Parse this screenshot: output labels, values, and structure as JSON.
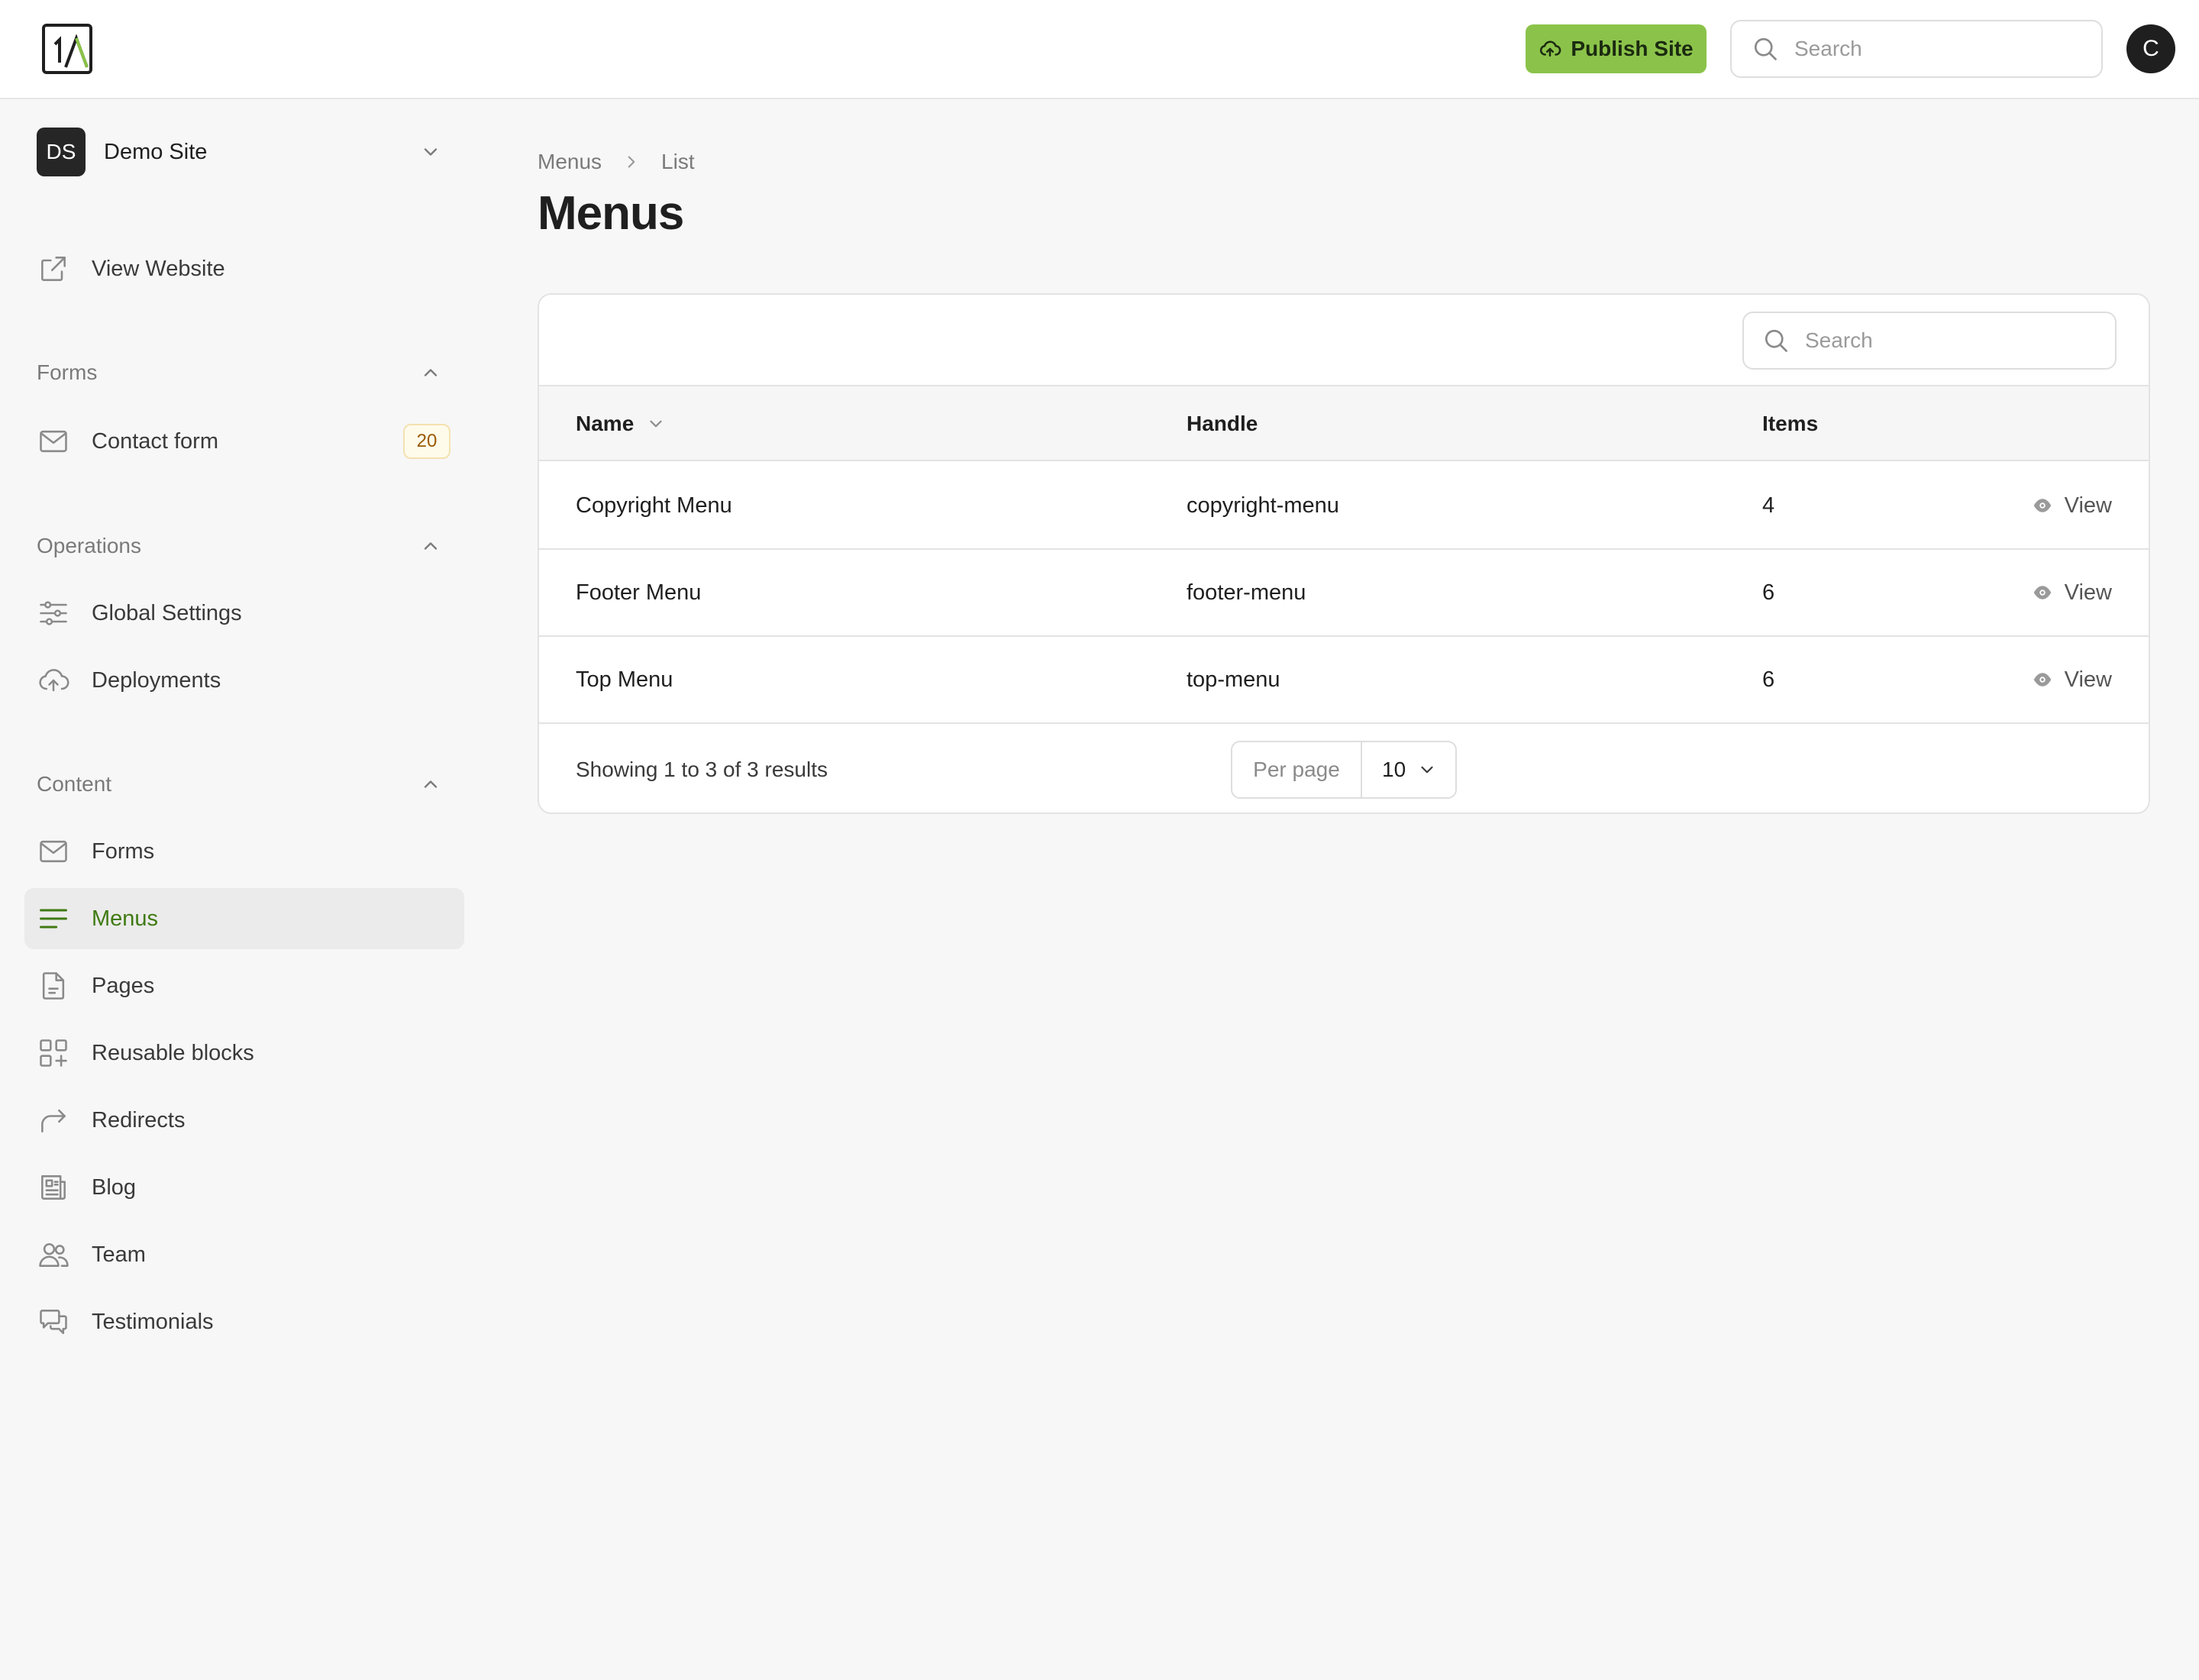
{
  "header": {
    "publish_label": "Publish Site",
    "search_placeholder": "Search",
    "avatar_initial": "C"
  },
  "colors": {
    "accent": "#8bc34a",
    "active_text": "#3f7a12"
  },
  "sidebar": {
    "site": {
      "initials": "DS",
      "name": "Demo Site"
    },
    "view_website": "View Website",
    "sections": {
      "forms": {
        "label": "Forms",
        "items": [
          {
            "label": "Contact form",
            "badge": "20",
            "icon": "envelope-icon"
          }
        ]
      },
      "operations": {
        "label": "Operations",
        "items": [
          {
            "label": "Global Settings",
            "icon": "sliders-icon"
          },
          {
            "label": "Deployments",
            "icon": "cloud-upload-icon"
          }
        ]
      },
      "content": {
        "label": "Content",
        "items": [
          {
            "label": "Forms",
            "icon": "envelope-icon"
          },
          {
            "label": "Menus",
            "icon": "menu-lines-icon",
            "active": true
          },
          {
            "label": "Pages",
            "icon": "document-icon"
          },
          {
            "label": "Reusable blocks",
            "icon": "blocks-icon"
          },
          {
            "label": "Redirects",
            "icon": "redirect-arrow-icon"
          },
          {
            "label": "Blog",
            "icon": "newspaper-icon"
          },
          {
            "label": "Team",
            "icon": "users-icon"
          },
          {
            "label": "Testimonials",
            "icon": "chat-bubbles-icon"
          }
        ]
      }
    }
  },
  "main": {
    "breadcrumb": [
      "Menus",
      "List"
    ],
    "title": "Menus",
    "table": {
      "search_placeholder": "Search",
      "columns": {
        "name": "Name",
        "handle": "Handle",
        "items": "Items"
      },
      "rows": [
        {
          "name": "Copyright Menu",
          "handle": "copyright-menu",
          "items": "4",
          "action": "View"
        },
        {
          "name": "Footer Menu",
          "handle": "footer-menu",
          "items": "6",
          "action": "View"
        },
        {
          "name": "Top Menu",
          "handle": "top-menu",
          "items": "6",
          "action": "View"
        }
      ],
      "footer": {
        "results": "Showing 1 to 3 of 3 results",
        "per_page_label": "Per page",
        "per_page_value": "10"
      }
    }
  }
}
